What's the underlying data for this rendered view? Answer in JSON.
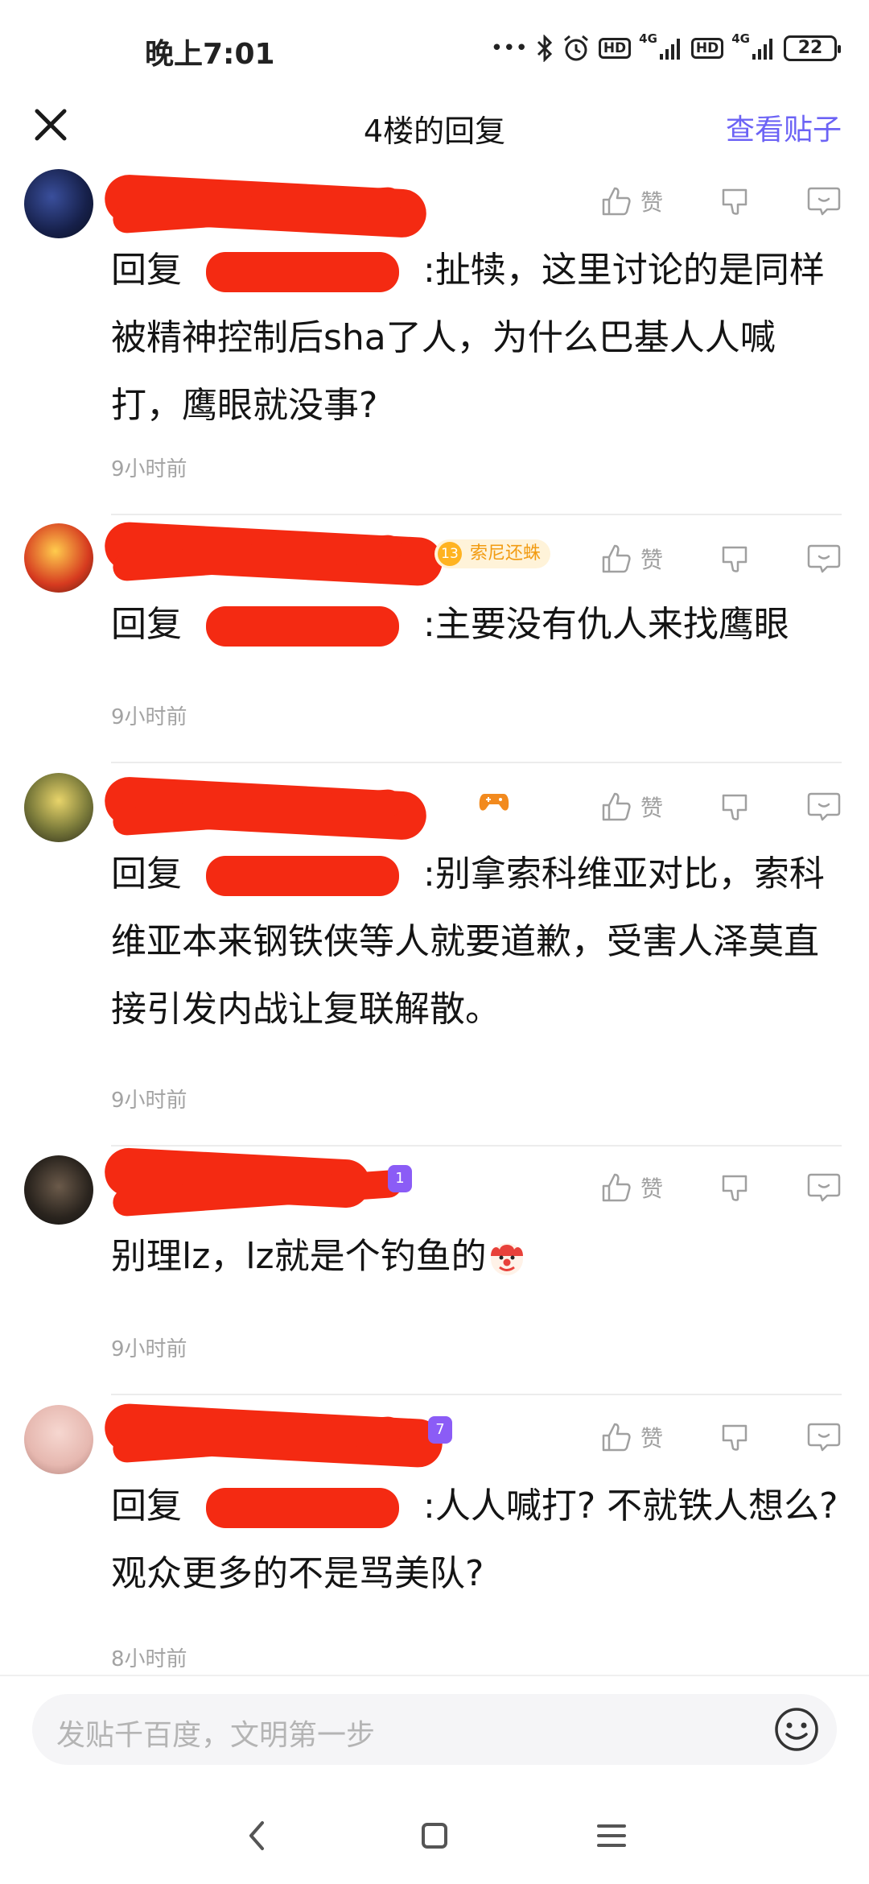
{
  "status": {
    "time": "晚上7:01",
    "hd1": "HD",
    "net1": "4G",
    "hd2": "HD",
    "net2": "4G",
    "battery": "22"
  },
  "header": {
    "title": "4楼的回复",
    "view_post": "查看贴子"
  },
  "like_label": "赞",
  "replies": [
    {
      "prefix": "回复",
      "text": ":扯犊，这里讨论的是同样被精神控制后sha了人，为什么巴基人人喊打，鹰眼就没事?",
      "time": "9小时前"
    },
    {
      "prefix": "回复",
      "text": ":主要没有仇人来找鹰眼",
      "time": "9小时前",
      "badge_level": "13",
      "badge_text": "索尼还蛛"
    },
    {
      "prefix": "回复",
      "text": ":别拿索科维亚对比，索科维亚本来钢铁侠等人就要道歉，受害人泽莫直接引发内战让复联解散。",
      "time": "9小时前"
    },
    {
      "prefix": "",
      "text": "别理lz，lz就是个钓鱼的",
      "time": "9小时前",
      "badge_num": "1"
    },
    {
      "prefix": "回复",
      "text": ":人人喊打? 不就铁人想么? 观众更多的不是骂美队?",
      "time": "8小时前",
      "badge_num": "7"
    }
  ],
  "composer": {
    "placeholder": "发贴千百度，文明第一步"
  },
  "colors": {
    "accent": "#6c63f5",
    "redaction": "#f42a12"
  }
}
